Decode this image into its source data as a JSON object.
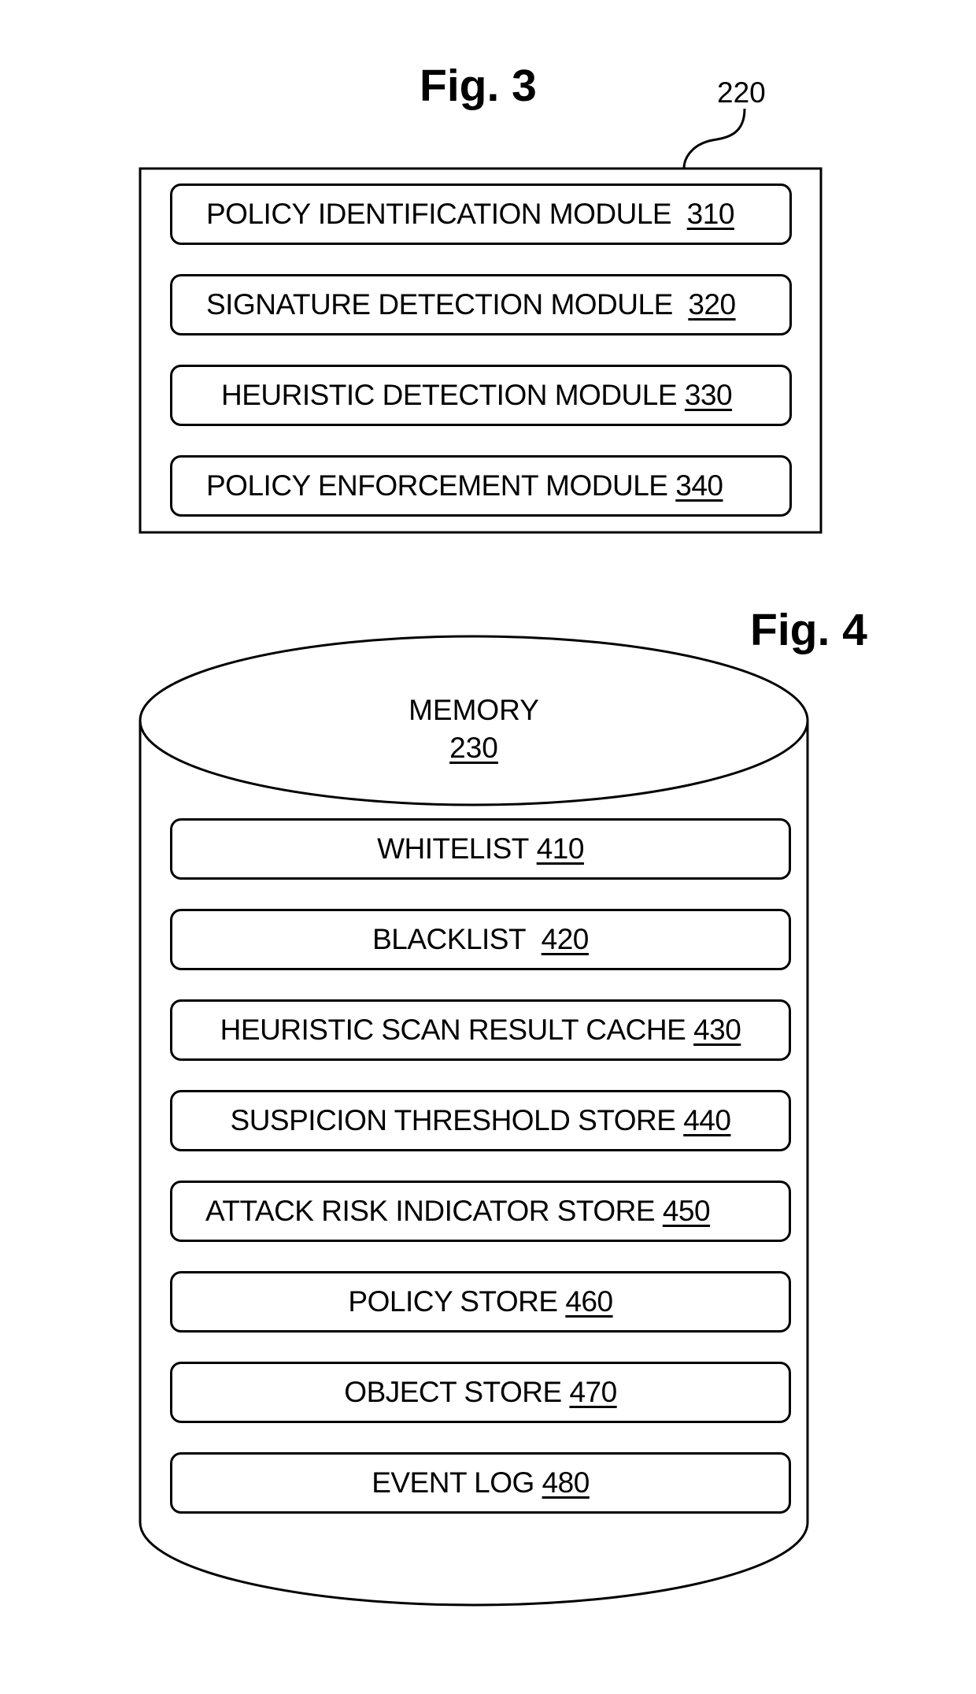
{
  "fig3": {
    "title": "Fig. 3",
    "ref_label": "220",
    "modules": [
      {
        "label": "POLICY IDENTIFICATION MODULE",
        "number": "310"
      },
      {
        "label": "SIGNATURE DETECTION MODULE",
        "number": "320"
      },
      {
        "label": "HEURISTIC DETECTION MODULE",
        "number": "330"
      },
      {
        "label": "POLICY ENFORCEMENT MODULE",
        "number": "340"
      }
    ]
  },
  "fig4": {
    "title": "Fig. 4",
    "memory_label": "MEMORY",
    "memory_number": "230",
    "stores": [
      {
        "label": "WHITELIST",
        "number": "410"
      },
      {
        "label": "BLACKLIST",
        "number": "420"
      },
      {
        "label": "HEURISTIC SCAN RESULT CACHE",
        "number": "430"
      },
      {
        "label": "SUSPICION THRESHOLD STORE",
        "number": "440"
      },
      {
        "label": "ATTACK RISK INDICATOR STORE",
        "number": "450"
      },
      {
        "label": "POLICY STORE",
        "number": "460"
      },
      {
        "label": "OBJECT STORE",
        "number": "470"
      },
      {
        "label": "EVENT LOG",
        "number": "480"
      }
    ]
  }
}
